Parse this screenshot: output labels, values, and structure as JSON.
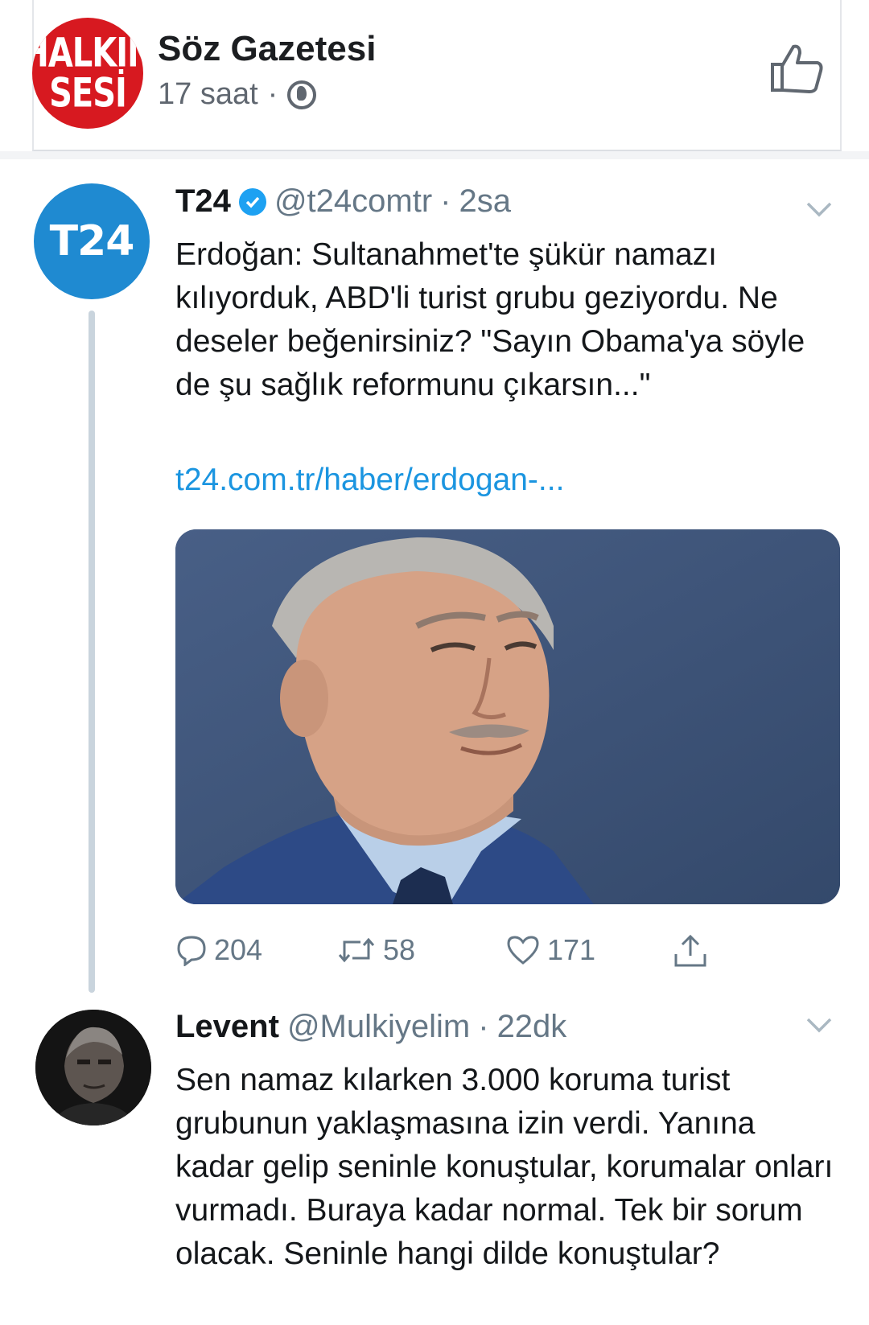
{
  "fb_post": {
    "page_name": "Söz Gazetesi",
    "avatar_text_line1": "HALKIN",
    "avatar_text_line2": "SESİ",
    "time": "17 saat",
    "separator": "·",
    "privacy_icon": "globe-icon",
    "like_icon": "thumbs-up-icon"
  },
  "tweet": {
    "avatar_text": "T24",
    "name": "T24",
    "verified_icon": "verified-badge-icon",
    "handle": "@t24comtr",
    "separator": "·",
    "time": "2sa",
    "text": "Erdoğan: Sultanahmet'te şükür namazı kılıyorduk, ABD'li turist grubu geziyordu. Ne deseler beğenirsiniz? \"Sayın Obama'ya söyle de şu sağlık reformunu çıkarsın...\"",
    "link": "t24.com.tr/haber/erdogan-...",
    "media": "photo",
    "replies": "204",
    "retweets": "58",
    "likes": "171",
    "colors": {
      "link": "#1b95e0",
      "avatar_bg": "#1f8ad1",
      "photo_bg": "#3e5478"
    }
  },
  "reply": {
    "name": "Levent",
    "handle": "@Mulkiyelim",
    "separator": "·",
    "time": "22dk",
    "text": "Sen namaz kılarken 3.000 koruma turist grubunun yaklaşmasına izin verdi. Yanına kadar  gelip seninle konuştular, korumalar onları vurmadı. Buraya kadar normal. Tek bir sorum olacak. Seninle hangi dilde konuştular?"
  }
}
